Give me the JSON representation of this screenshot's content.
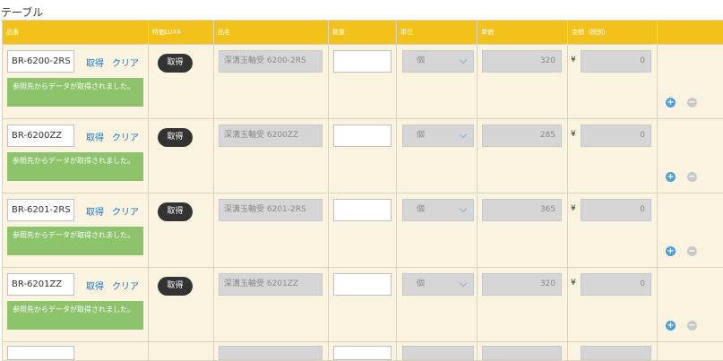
{
  "section_title": "テーブル",
  "headers": {
    "code": "品番",
    "lux": "特価LUX4",
    "name": "品名",
    "qty": "数量",
    "unit": "単位",
    "price": "単価",
    "amount": "金額（税別）"
  },
  "labels": {
    "get_link": "取得",
    "clear_link": "クリア",
    "get_button": "取得",
    "note": "参照先からデータが取得されました。",
    "yen": "¥",
    "add_icon": "+",
    "remove_icon": "−"
  },
  "rows": [
    {
      "code": "BR-6200-2RS",
      "name": "深溝玉軸受 6200-2RS",
      "qty": "",
      "unit": "個",
      "price": "320",
      "amount": "0"
    },
    {
      "code": "BR-6200ZZ",
      "name": "深溝玉軸受 6200ZZ",
      "qty": "",
      "unit": "個",
      "price": "285",
      "amount": "0"
    },
    {
      "code": "BR-6201-2RS",
      "name": "深溝玉軸受 6201-2RS",
      "qty": "",
      "unit": "個",
      "price": "365",
      "amount": "0"
    },
    {
      "code": "BR-6201ZZ",
      "name": "深溝玉軸受 6201ZZ",
      "qty": "",
      "unit": "個",
      "price": "320",
      "amount": "0"
    }
  ],
  "colors": {
    "header": "#f2c21b",
    "cell": "#f9f3df",
    "note": "#8cc36b",
    "link": "#1a73c8",
    "add": "#4aa0dd"
  }
}
